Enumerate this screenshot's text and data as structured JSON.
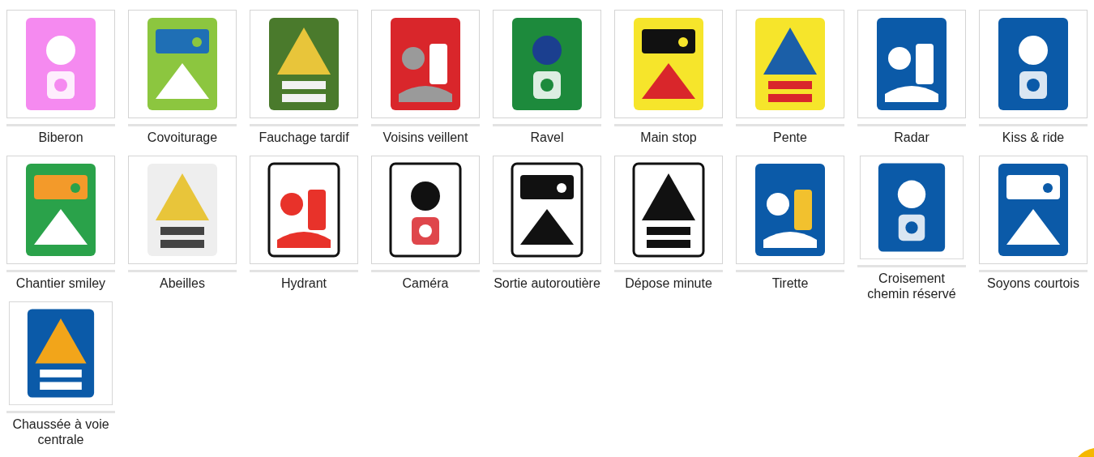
{
  "signs": [
    {
      "caption": [
        "Biberon"
      ]
    },
    {
      "caption": [
        "Covoiturage"
      ]
    },
    {
      "caption": [
        "Fauchage tardif"
      ]
    },
    {
      "caption": [
        "Voisins veillent"
      ]
    },
    {
      "caption": [
        "Ravel"
      ]
    },
    {
      "caption": [
        "Main stop"
      ]
    },
    {
      "caption": [
        "Pente"
      ]
    },
    {
      "caption": [
        "Radar"
      ]
    },
    {
      "caption": [
        "Kiss & ride"
      ]
    },
    {
      "caption": [
        "Chantier smiley"
      ]
    },
    {
      "caption": [
        "Abeilles"
      ]
    },
    {
      "caption": [
        "Hydrant"
      ]
    },
    {
      "caption": [
        "Caméra"
      ]
    },
    {
      "caption": [
        "Sortie autoroutière"
      ]
    },
    {
      "caption": [
        "Dépose minute"
      ]
    },
    {
      "caption": [
        "Tirette"
      ]
    },
    {
      "caption": [
        "Croisement",
        "chemin réservé"
      ]
    },
    {
      "caption": [
        "Soyons courtois"
      ]
    },
    {
      "caption": [
        "Chaussée à voie",
        "centrale"
      ]
    }
  ]
}
